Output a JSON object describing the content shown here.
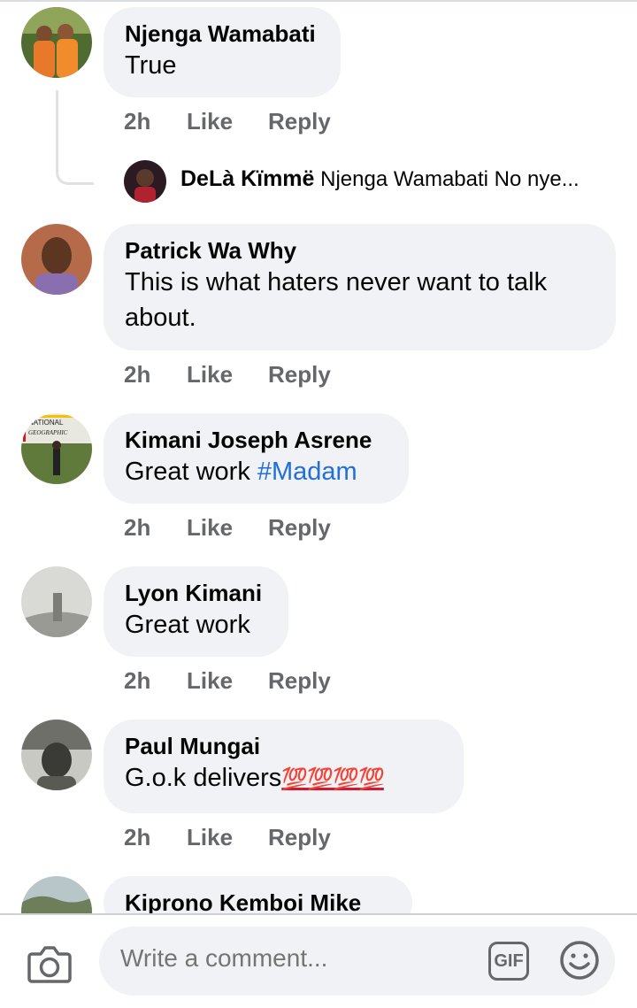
{
  "comments": [
    {
      "name": "Njenga Wamabati",
      "text": "True",
      "time": "2h",
      "like": "Like",
      "reply": "Reply",
      "reply_preview": {
        "name": "DeLà Kïmmë",
        "text": "Njenga Wamabati No nye..."
      }
    },
    {
      "name": "Patrick Wa Why",
      "text_line1": "This is what haters never want to talk",
      "text_line2": "about.",
      "time": "2h",
      "like": "Like",
      "reply": "Reply"
    },
    {
      "name": "Kimani Joseph Asrene",
      "text": "Great work ",
      "hashtag": "#Madam",
      "time": "2h",
      "like": "Like",
      "reply": "Reply",
      "avatar_logo_line1": "NATIONAL",
      "avatar_logo_line2": "GEOGRAPHIC"
    },
    {
      "name": "Lyon Kimani",
      "text": "Great work",
      "time": "2h",
      "like": "Like",
      "reply": "Reply"
    },
    {
      "name": "Paul Mungai",
      "text": "G.o.k delivers",
      "emoji": "💯💯💯💯",
      "time": "2h",
      "like": "Like",
      "reply": "Reply"
    },
    {
      "name": "Kiprono Kemboi Mike"
    }
  ],
  "composer": {
    "placeholder": "Write a comment...",
    "gif_label": "GIF"
  },
  "icons": {
    "camera": "camera-icon",
    "gif": "gif-icon",
    "emoji": "emoji-icon"
  },
  "colors": {
    "bubble": "#f0f2f5",
    "meta": "#65676b",
    "hashtag": "#216fdb",
    "emoji_red": "#d6172f"
  }
}
